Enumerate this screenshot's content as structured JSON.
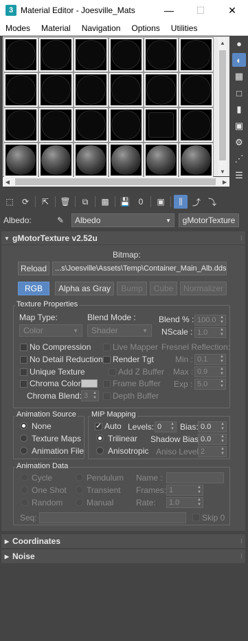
{
  "window": {
    "title": "Material Editor - Joesville_Mats",
    "app_icon": "3"
  },
  "menu": [
    "Modes",
    "Material",
    "Navigation",
    "Options",
    "Utilities"
  ],
  "toolbar": {
    "reset_icon_label": "X",
    "zero_icon_label": "0"
  },
  "name_row": {
    "label": "Albedo:",
    "material_name": "Albedo",
    "type_button": "gMotorTexture"
  },
  "rollout": {
    "title": "gMotorTexture v2.52u",
    "bitmap_label": "Bitmap:",
    "reload_label": "Reload",
    "bitmap_path": "...s\\Joesville\\Assets\\Temp\\Container_Main_Alb.dds",
    "channel_buttons": [
      "RGB",
      "Alpha as Gray",
      "Bump",
      "Cube",
      "Normalizer"
    ],
    "texture_properties": {
      "title": "Texture Properties",
      "map_type_label": "Map Type:",
      "map_type_value": "Color",
      "blend_mode_label": "Blend Mode :",
      "blend_mode_value": "Shader",
      "blend_pct_label": "Blend % :",
      "blend_pct_value": "100.0",
      "nscale_label": "NScale :",
      "nscale_value": "1.0",
      "no_compression": "No Compression",
      "live_mapper": "Live Mapper",
      "fresnel_label": "Fresnel Reflection:",
      "no_detail_reduction": "No Detail Reduction",
      "render_tgt": "Render Tgt",
      "min_label": "Min :",
      "min_value": "0.1",
      "unique_texture": "Unique Texture",
      "add_z_buffer": "Add Z Buffer",
      "max_label": "Max :",
      "max_value": "0.9",
      "chroma_color": "Chroma Color:",
      "frame_buffer": "Frame Buffer",
      "exp_label": "Exp :",
      "exp_value": "5.0",
      "chroma_blend_label": "Chroma Blend:",
      "chroma_blend_value": "3",
      "depth_buffer": "Depth Buffer"
    },
    "animation_source": {
      "title": "Animation Source",
      "options": [
        "None",
        "Texture Maps",
        "Animation File"
      ],
      "selected": "None"
    },
    "mip_mapping": {
      "title": "MIP Mapping",
      "auto_label": "Auto",
      "levels_label": "Levels:",
      "levels_value": "0",
      "bias_label": "Bias:",
      "bias_value": "0.0",
      "trilinear": "Trilinear",
      "shadow_bias_label": "Shadow Bias:",
      "shadow_bias_value": "0.0",
      "anisotropic": "Anisotropic",
      "aniso_level_label": "Aniso Level:",
      "aniso_level_value": "2"
    },
    "animation_data": {
      "title": "Animation Data",
      "cycle": "Cycle",
      "pendulum": "Pendulum",
      "name_label": "Name :",
      "one_shot": "One Shot",
      "transient": "Transient",
      "frames_label": "Frames:",
      "frames_value": "1",
      "random": "Random",
      "manual": "Manual",
      "rate_label": "Rate:",
      "rate_value": "1.0",
      "seq_label": "Seq:",
      "skip_label": "Skip 0"
    }
  },
  "collapsed_rollouts": [
    "Coordinates",
    "Noise"
  ]
}
